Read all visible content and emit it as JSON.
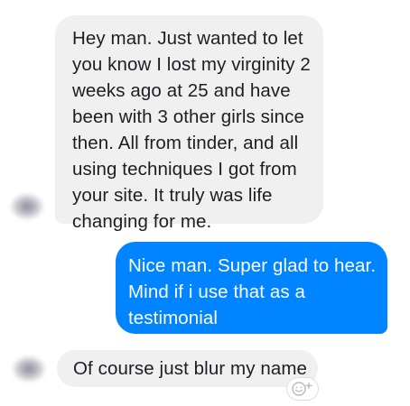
{
  "messages": [
    {
      "direction": "incoming",
      "text": "Hey man. Just wanted to let\nyou know I lost my virginity 2\nweeks ago at 25 and have\nbeen with 3 other girls since\nthen. All from tinder, and all\nusing techniques I got from\nyour site. It truly was life\nchanging for me."
    },
    {
      "direction": "outgoing",
      "text": "Nice man. Super glad to hear.\nMind if i use that as a\ntestimonial"
    },
    {
      "direction": "incoming",
      "text": "Of course just blur my name"
    }
  ],
  "reaction_button": {
    "icon": "smiley-plus-icon"
  },
  "colors": {
    "incoming_bubble": "#f1f0f0",
    "outgoing_bubble": "#0084ff",
    "incoming_text": "#1c1e21",
    "outgoing_text": "#ffffff"
  }
}
